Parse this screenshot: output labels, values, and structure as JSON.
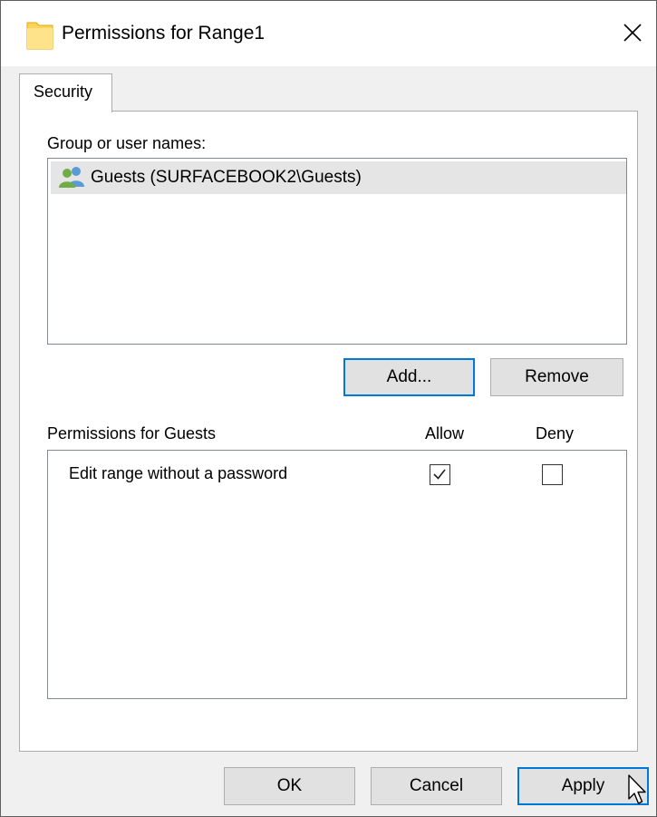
{
  "window": {
    "title": "Permissions for Range1",
    "icon": "folder-icon"
  },
  "tabs": [
    {
      "label": "Security",
      "active": true
    }
  ],
  "users_section": {
    "label": "Group or user names:",
    "users": [
      {
        "icon": "user-group-icon",
        "name": "Guests (SURFACEBOOK2\\Guests)",
        "selected": true
      }
    ],
    "add_label": "Add...",
    "remove_label": "Remove"
  },
  "permissions": {
    "label": "Permissions for Guests",
    "allow_header": "Allow",
    "deny_header": "Deny",
    "items": [
      {
        "name": "Edit range without a password",
        "allow": true,
        "deny": false
      }
    ]
  },
  "footer": {
    "ok_label": "OK",
    "cancel_label": "Cancel",
    "apply_label": "Apply"
  },
  "colors": {
    "focus_border": "#0078d7",
    "button_face": "#e1e1e1",
    "selection": "#e5e5e5",
    "folder": "#ffd35c"
  }
}
